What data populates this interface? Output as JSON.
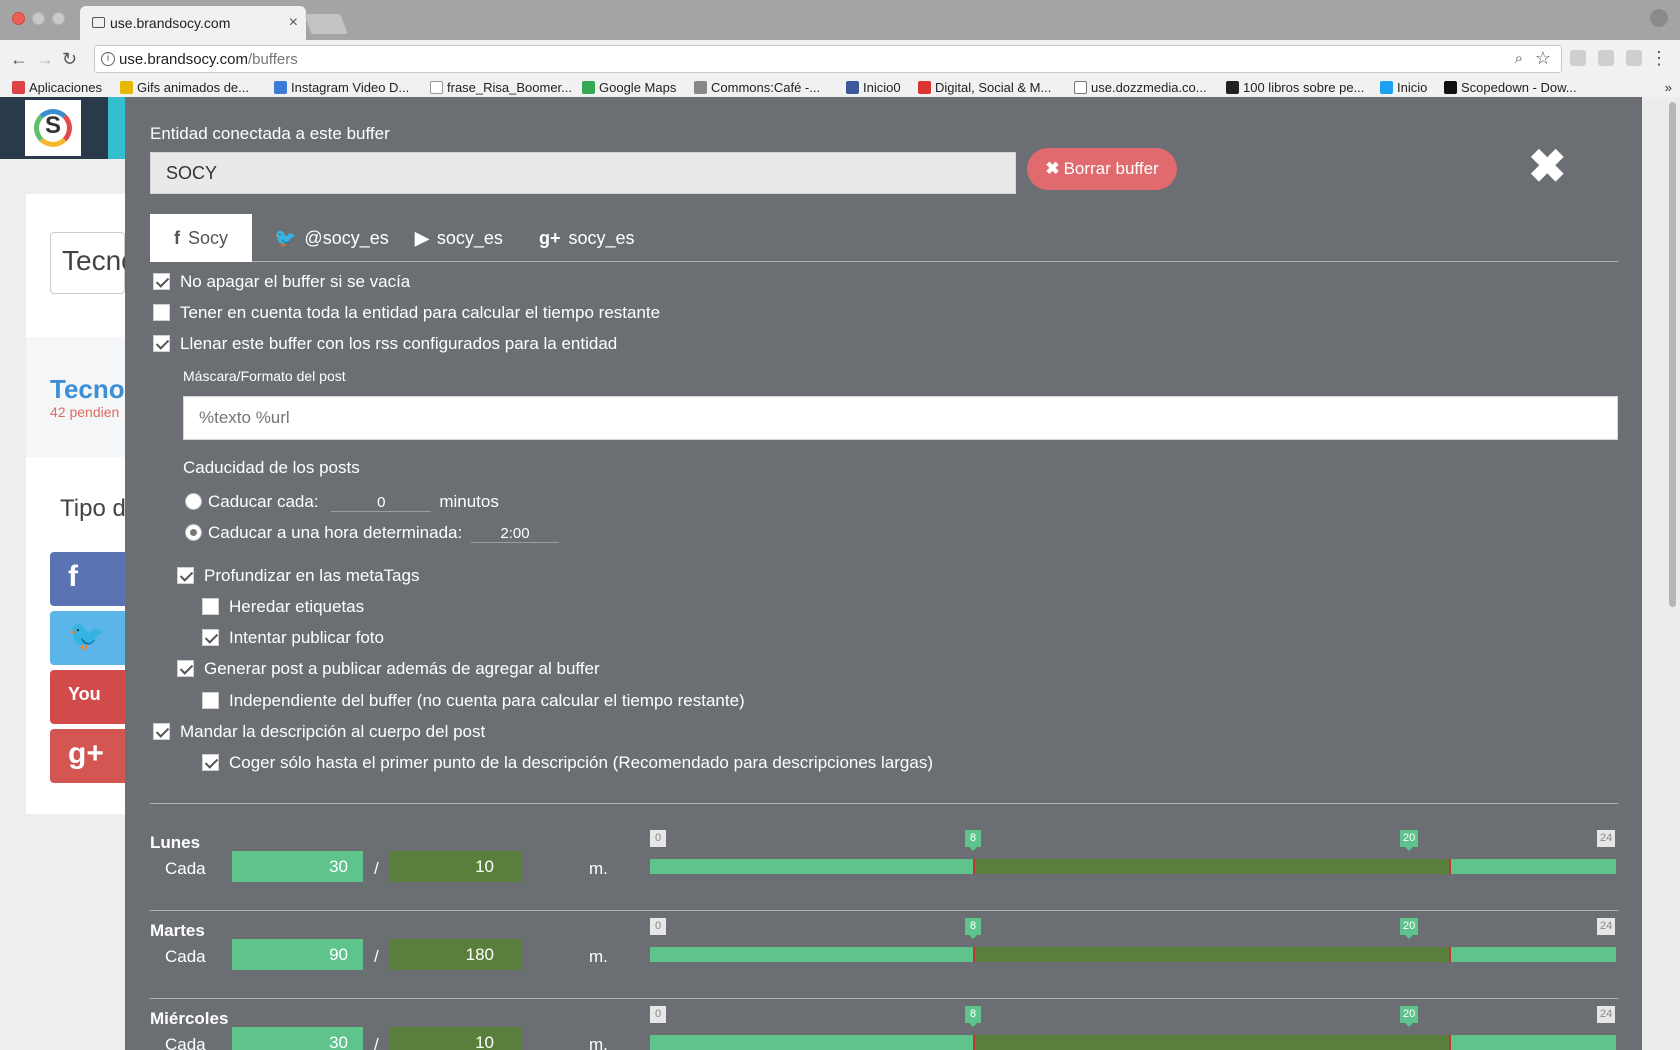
{
  "browser": {
    "tab_title": "use.brandsocy.com",
    "tab_close": "×",
    "url_host": "use.brandsocy.com",
    "url_path": "/buffers",
    "bookmarks": [
      {
        "label": "Aplicaciones",
        "color": "#d44"
      },
      {
        "label": "Gifs animados de...",
        "color": "#e6b800"
      },
      {
        "label": "Instagram Video D...",
        "color": "#3a7bd5"
      },
      {
        "label": "frase_Risa_Boomer...",
        "color": "#999"
      },
      {
        "label": "Google Maps",
        "color": "#34a853"
      },
      {
        "label": "Commons:Café -...",
        "color": "#888"
      },
      {
        "label": "Inicio0",
        "color": "#3b5998"
      },
      {
        "label": "Digital, Social & M...",
        "color": "#d33"
      },
      {
        "label": "use.dozzmedia.co...",
        "color": "#777"
      },
      {
        "label": "100 libros sobre pe...",
        "color": "#222"
      },
      {
        "label": "Inicio",
        "color": "#1da1f2"
      },
      {
        "label": "Scopedown - Dow...",
        "color": "#111"
      }
    ],
    "more": "»"
  },
  "background": {
    "search_text": "Tecno",
    "section_title": "Tecno",
    "pending": "42 pendien",
    "tipo": "Tipo d"
  },
  "modal": {
    "entity_label": "Entidad conectada a este buffer",
    "entity_value": "SOCY",
    "delete_label": "Borrar buffer",
    "tabs": [
      {
        "icon": "f",
        "label": "Socy",
        "active": true
      },
      {
        "icon": "🐦",
        "label": "@socy_es",
        "active": false
      },
      {
        "icon": "▶",
        "label": "socy_es",
        "active": false
      },
      {
        "icon": "g+",
        "label": "socy_es",
        "active": false
      }
    ],
    "options": {
      "no_apagar": "No apagar el buffer si se vacía",
      "tener_cuenta": "Tener en cuenta toda la entidad para calcular el tiempo restante",
      "llenar_rss": "Llenar este buffer con los rss configurados para la entidad",
      "mascara_label": "Máscara/Formato del post",
      "mascara_placeholder": "%texto %url",
      "caducidad_label": "Caducidad de los posts",
      "caducar_cada": "Caducar cada:",
      "caducar_cada_value": "0",
      "minutos": "minutos",
      "caducar_hora": "Caducar a una hora determinada:",
      "caducar_hora_value": "2:00",
      "profundizar": "Profundizar en las metaTags",
      "heredar": "Heredar etiquetas",
      "intentar_foto": "Intentar publicar foto",
      "generar_post": "Generar post a publicar además de agregar al buffer",
      "independiente": "Independiente del buffer (no cuenta para calcular el tiempo restante)",
      "mandar_desc": "Mandar la descripción al cuerpo del post",
      "coger_solo": "Coger sólo hasta el primer punto de la descripción (Recomendado para descripciones largas)"
    },
    "schedule": {
      "cada_label": "Cada",
      "unit": "m.",
      "range_min": "0",
      "range_max": "24",
      "start": "8",
      "end": "20",
      "days": [
        {
          "name": "Lunes",
          "a": "30",
          "b": "10"
        },
        {
          "name": "Martes",
          "a": "90",
          "b": "180"
        },
        {
          "name": "Miércoles",
          "a": "30",
          "b": "10"
        }
      ]
    }
  },
  "colors": {
    "modal_bg": "#6b6f73",
    "green_light": "#5ec48b",
    "green_dark": "#5a7f3d",
    "delete_red": "#e06a6d"
  }
}
